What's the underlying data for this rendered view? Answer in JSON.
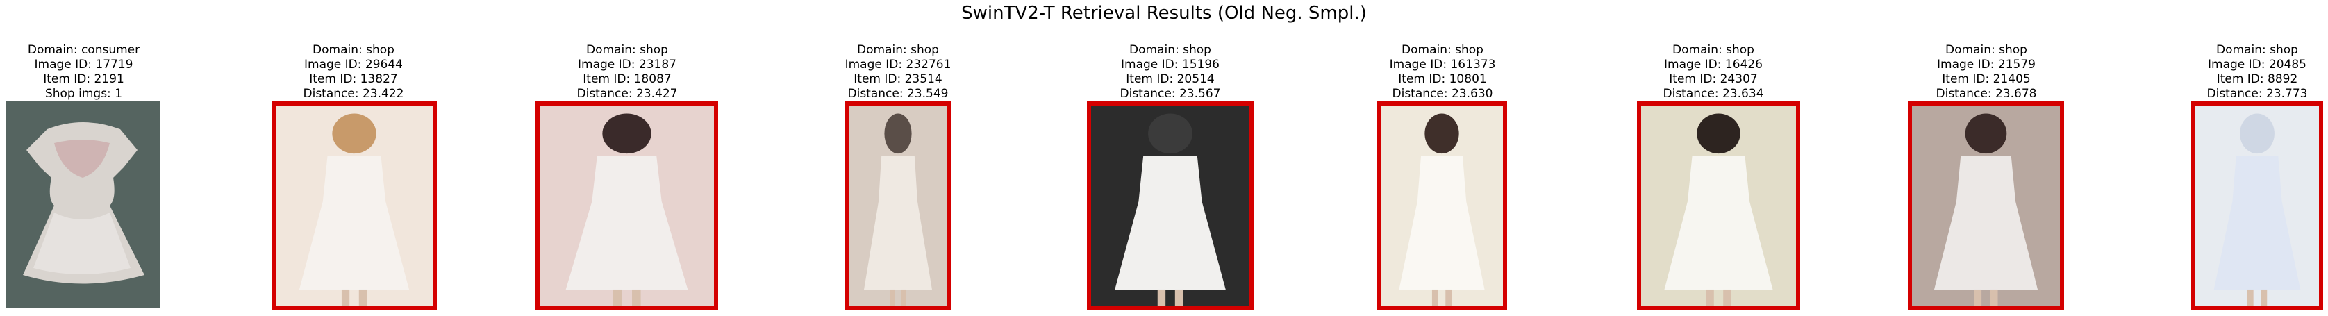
{
  "figure": {
    "title": "SwinTV2-T Retrieval Results (Old Neg. Smpl.)"
  },
  "query": {
    "domain": "Domain: consumer",
    "image_id": "Image ID: 17719",
    "item_id": "Item ID: 2191",
    "shop_imgs": "Shop imgs: 1",
    "image_desc": "consumer photo of a white lace dress laid flat on a dark green surface"
  },
  "results": [
    {
      "domain": "Domain: shop",
      "image_id": "Image ID: 29644",
      "item_id": "Item ID: 13827",
      "distance": "Distance: 23.422",
      "highlight": "red"
    },
    {
      "domain": "Domain: shop",
      "image_id": "Image ID: 23187",
      "item_id": "Item ID: 18087",
      "distance": "Distance: 23.427",
      "highlight": "red"
    },
    {
      "domain": "Domain: shop",
      "image_id": "Image ID: 232761",
      "item_id": "Item ID: 23514",
      "distance": "Distance: 23.549",
      "highlight": "red"
    },
    {
      "domain": "Domain: shop",
      "image_id": "Image ID: 15196",
      "item_id": "Item ID: 20514",
      "distance": "Distance: 23.567",
      "highlight": "red"
    },
    {
      "domain": "Domain: shop",
      "image_id": "Image ID: 161373",
      "item_id": "Item ID: 10801",
      "distance": "Distance: 23.630",
      "highlight": "red"
    },
    {
      "domain": "Domain: shop",
      "image_id": "Image ID: 16426",
      "item_id": "Item ID: 24307",
      "distance": "Distance: 23.634",
      "highlight": "red"
    },
    {
      "domain": "Domain: shop",
      "image_id": "Image ID: 21579",
      "item_id": "Item ID: 21405",
      "distance": "Distance: 23.678",
      "highlight": "red"
    },
    {
      "domain": "Domain: shop",
      "image_id": "Image ID: 20485",
      "item_id": "Item ID: 8892",
      "distance": "Distance: 23.773",
      "highlight": "red"
    }
  ],
  "colors": {
    "mismatch_border": "#d40000",
    "consumer_bg": "#4f5d5a"
  }
}
